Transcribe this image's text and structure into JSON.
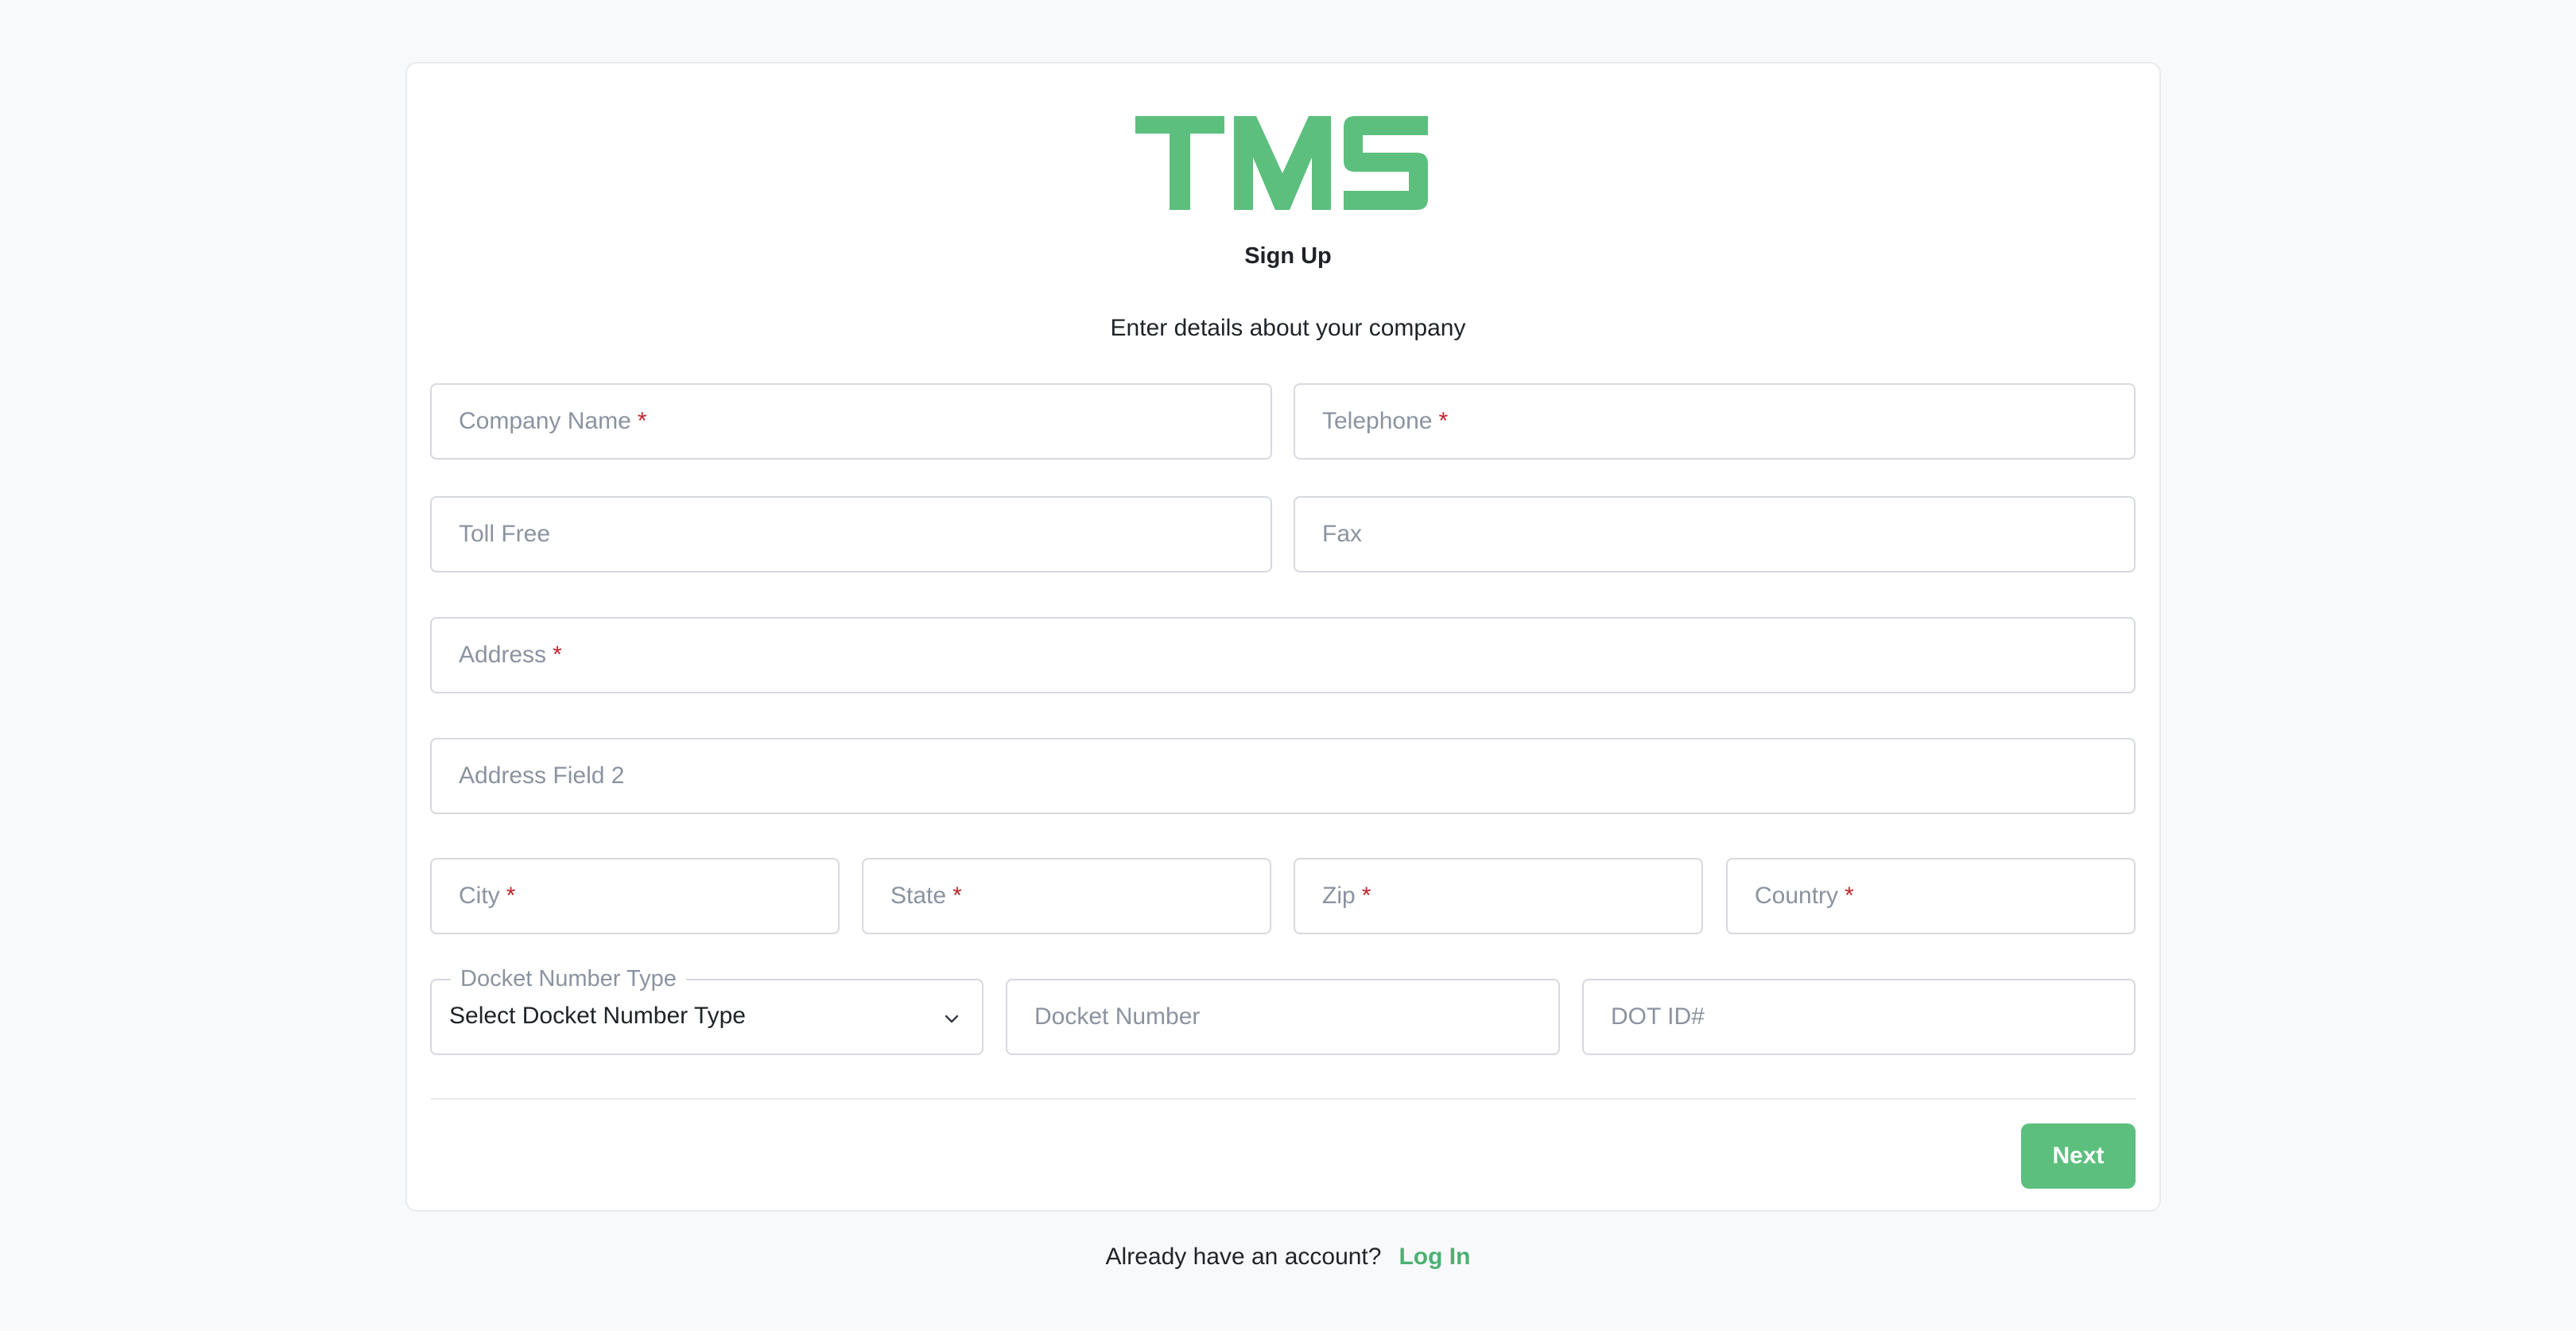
{
  "brand": {
    "logo_text": "TMS",
    "color": "#5cbf7e"
  },
  "header": {
    "title": "Sign Up",
    "subtitle": "Enter details about your company"
  },
  "form": {
    "company_name": {
      "placeholder": "Company Name",
      "required": "*"
    },
    "telephone": {
      "placeholder": "Telephone",
      "required": "*"
    },
    "toll_free": {
      "placeholder": "Toll Free"
    },
    "fax": {
      "placeholder": "Fax"
    },
    "address": {
      "placeholder": "Address",
      "required": "*"
    },
    "address_2": {
      "placeholder": "Address Field 2"
    },
    "city": {
      "placeholder": "City",
      "required": "*"
    },
    "state": {
      "placeholder": "State",
      "required": "*"
    },
    "zip": {
      "placeholder": "Zip",
      "required": "*"
    },
    "country": {
      "placeholder": "Country",
      "required": "*"
    },
    "docket_type": {
      "label": "Docket Number Type",
      "selected": "Select Docket Number Type"
    },
    "docket_number": {
      "placeholder": "Docket Number"
    },
    "dot_id": {
      "placeholder": "DOT ID#"
    }
  },
  "actions": {
    "next_label": "Next"
  },
  "footer": {
    "prompt": "Already have an account?",
    "login_label": "Log In"
  },
  "icons": {
    "select_arrow": "chevron-down-icon"
  }
}
